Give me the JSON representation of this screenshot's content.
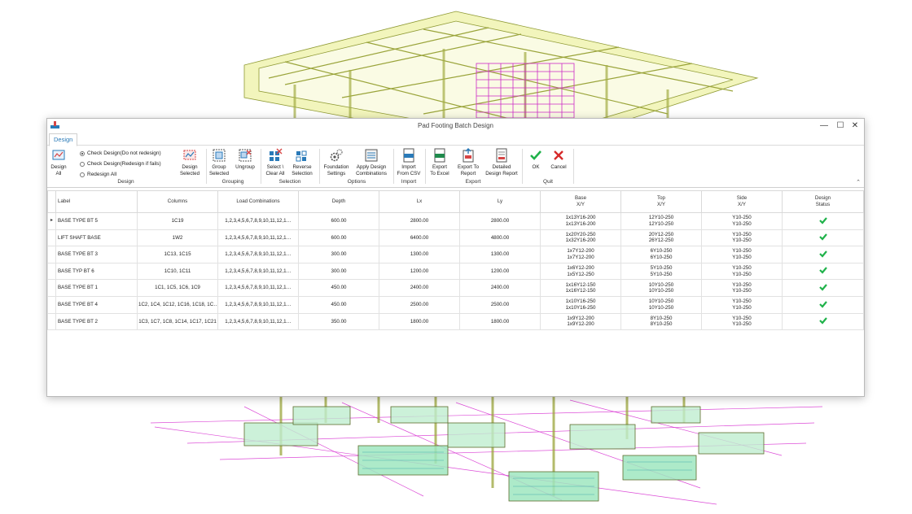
{
  "window": {
    "title": "Pad Footing Batch Design",
    "controls": {
      "minimize": "—",
      "maximize": "☐",
      "close": "✕"
    }
  },
  "ribbon": {
    "tab": "Design",
    "buttons": {
      "design_all": "Design\nAll",
      "design_selected": "Design\nSelected",
      "group_selected": "Group\nSelected",
      "ungroup": "Ungroup",
      "select_clear_all": "Select \\\nClear All",
      "reverse_selection": "Reverse\nSelection",
      "foundation_settings": "Foundation\nSettings",
      "apply_design_combinations": "Apply Design\nCombinations",
      "import_from_csv": "Import\nFrom CSV",
      "export_to_excel": "Export\nTo Excel",
      "export_to_report": "Export To\nReport",
      "detailed_design_report": "Detailed\nDesign Report",
      "ok": "OK",
      "cancel": "Cancel"
    },
    "radios": [
      {
        "label": "Check Design(Do not redesign)",
        "selected": true
      },
      {
        "label": "Check Design(Redesign if fails)",
        "selected": false
      },
      {
        "label": "Redesign All",
        "selected": false
      }
    ],
    "groups": {
      "design": "Design",
      "grouping": "Grouping",
      "selection": "Selection",
      "options": "Options",
      "import": "Import",
      "export": "Export",
      "quit": "Quit"
    },
    "collapse": "⌃"
  },
  "table": {
    "headers": {
      "label": "Label",
      "columns": "Columns",
      "load": "Load Combinations",
      "depth": "Depth",
      "lx": "Lx",
      "ly": "Ly",
      "base": "Base",
      "top": "Top",
      "side": "Side",
      "xy": "X/Y",
      "design": "Design",
      "status": "Status"
    },
    "selected_marker": "▸",
    "rows": [
      {
        "label": "BASE TYPE BT 5",
        "columns": "1C19",
        "load": "1,2,3,4,5,6,7,8,9,10,11,12,1…",
        "depth": "600.00",
        "lx": "2800.00",
        "ly": "2800.00",
        "base1": "1x13Y16-200",
        "base2": "1x13Y16-200",
        "top1": "12Y10-250",
        "top2": "12Y10-250",
        "side1": "Y10-250",
        "side2": "Y10-250"
      },
      {
        "label": "LIFT SHAFT BASE",
        "columns": "1W2",
        "load": "1,2,3,4,5,6,7,8,9,10,11,12,1…",
        "depth": "600.00",
        "lx": "6400.00",
        "ly": "4800.00",
        "base1": "1x20Y20-250",
        "base2": "1x32Y16-200",
        "top1": "20Y12-250",
        "top2": "26Y12-250",
        "side1": "Y10-250",
        "side2": "Y10-250"
      },
      {
        "label": "BASE TYPE BT 3",
        "columns": "1C13, 1C15",
        "load": "1,2,3,4,5,6,7,8,9,10,11,12,1…",
        "depth": "300.00",
        "lx": "1300.00",
        "ly": "1300.00",
        "base1": "1x7Y12-200",
        "base2": "1x7Y12-200",
        "top1": "6Y10-250",
        "top2": "6Y10-250",
        "side1": "Y10-250",
        "side2": "Y10-250"
      },
      {
        "label": "BASE TYP BT 6",
        "columns": "1C10, 1C11",
        "load": "1,2,3,4,5,6,7,8,9,10,11,12,1…",
        "depth": "300.00",
        "lx": "1200.00",
        "ly": "1200.00",
        "base1": "1x6Y12-200",
        "base2": "1x5Y12-250",
        "top1": "5Y10-250",
        "top2": "5Y10-250",
        "side1": "Y10-250",
        "side2": "Y10-250"
      },
      {
        "label": "BASE TYPE BT 1",
        "columns": "1C1, 1C5, 1C6, 1C9",
        "load": "1,2,3,4,5,6,7,8,9,10,11,12,1…",
        "depth": "450.00",
        "lx": "2400.00",
        "ly": "2400.00",
        "base1": "1x16Y12-150",
        "base2": "1x16Y12-150",
        "top1": "10Y10-250",
        "top2": "10Y10-250",
        "side1": "Y10-250",
        "side2": "Y10-250"
      },
      {
        "label": "BASE TYPE BT 4",
        "columns": "1C2, 1C4, 1C12, 1C16, 1C18, 1C…",
        "load": "1,2,3,4,5,6,7,8,9,10,11,12,1…",
        "depth": "450.00",
        "lx": "2500.00",
        "ly": "2500.00",
        "base1": "1x10Y16-250",
        "base2": "1x10Y16-250",
        "top1": "10Y10-250",
        "top2": "10Y10-250",
        "side1": "Y10-250",
        "side2": "Y10-250"
      },
      {
        "label": "BASE TYPE BT 2",
        "columns": "1C3, 1C7, 1C8, 1C14, 1C17, 1C21",
        "load": "1,2,3,4,5,6,7,8,9,10,11,12,1…",
        "depth": "350.00",
        "lx": "1800.00",
        "ly": "1800.00",
        "base1": "1x9Y12-200",
        "base2": "1x9Y12-200",
        "top1": "8Y10-250",
        "top2": "8Y10-250",
        "side1": "Y10-250",
        "side2": "Y10-250"
      }
    ]
  },
  "colors": {
    "beam": "#e9ee9a",
    "beam_edge": "#9aa03a",
    "rebar_pink": "#d62bd0",
    "green_check": "#1fb24a",
    "tab_blue": "#2a7ab8"
  },
  "icons": [
    "design-all-icon",
    "design-selected-icon",
    "group-icon",
    "ungroup-icon",
    "select-clear-icon",
    "reverse-selection-icon",
    "gear-icon",
    "combinations-icon",
    "csv-icon",
    "excel-icon",
    "report-export-icon",
    "detailed-report-icon",
    "check-icon",
    "cross-icon"
  ]
}
